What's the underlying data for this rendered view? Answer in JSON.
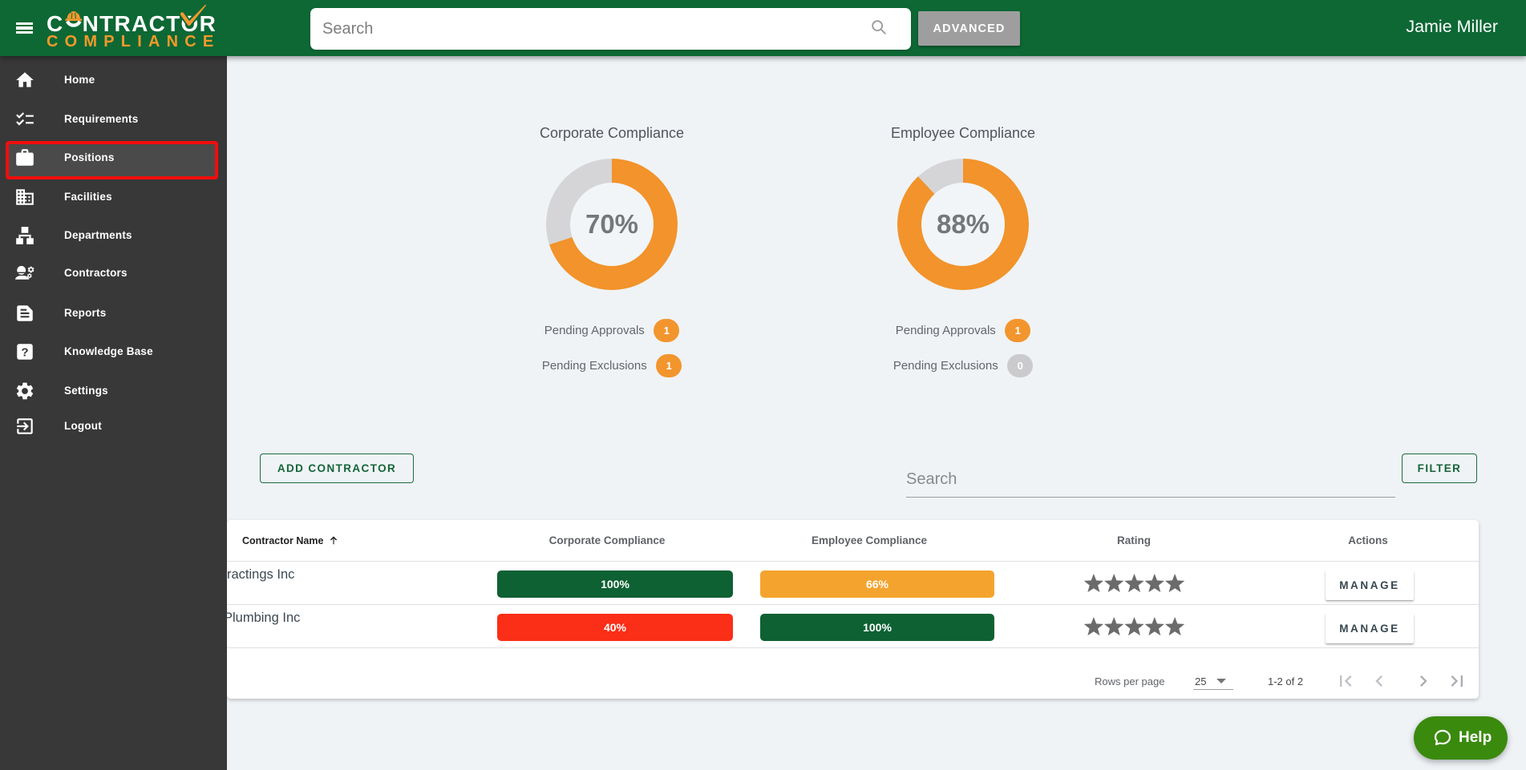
{
  "topbar": {
    "logo_line1": "CONTRACTOR",
    "logo_line2": "COMPLIANCE",
    "search_placeholder": "Search",
    "advanced_label": "ADVANCED",
    "user_name": "Jamie Miller"
  },
  "sidebar": {
    "items": [
      {
        "label": "Home"
      },
      {
        "label": "Requirements"
      },
      {
        "label": "Positions"
      },
      {
        "label": "Facilities"
      },
      {
        "label": "Departments"
      },
      {
        "label": "Contractors"
      },
      {
        "label": "Reports"
      },
      {
        "label": "Knowledge Base"
      },
      {
        "label": "Settings"
      },
      {
        "label": "Logout"
      }
    ]
  },
  "dashboard": {
    "corporate": {
      "title": "Corporate Compliance",
      "percent": "70%",
      "pending_approvals_label": "Pending Approvals",
      "pending_approvals": "1",
      "pending_exclusions_label": "Pending Exclusions",
      "pending_exclusions": "1"
    },
    "employee": {
      "title": "Employee Compliance",
      "percent": "88%",
      "pending_approvals_label": "Pending Approvals",
      "pending_approvals": "1",
      "pending_exclusions_label": "Pending Exclusions",
      "pending_exclusions": "0"
    }
  },
  "chart_data": [
    {
      "type": "pie",
      "title": "Corporate Compliance",
      "values": [
        70,
        30
      ],
      "labels": [
        "compliant",
        "remaining"
      ],
      "unit": "%",
      "center_label": "70%"
    },
    {
      "type": "pie",
      "title": "Employee Compliance",
      "values": [
        88,
        12
      ],
      "labels": [
        "compliant",
        "remaining"
      ],
      "unit": "%",
      "center_label": "88%"
    }
  ],
  "toolbar": {
    "add_contractor_label": "ADD CONTRACTOR",
    "search_placeholder": "Search",
    "filter_label": "FILTER"
  },
  "table": {
    "columns": {
      "name": "Contractor Name",
      "corporate": "Corporate Compliance",
      "employee": "Employee Compliance",
      "rating": "Rating",
      "actions": "Actions"
    },
    "rows": [
      {
        "name": "ractings Inc",
        "corporate": "100%",
        "corporate_level": "green",
        "employee": "66%",
        "employee_level": "orange",
        "rating": 5,
        "action_label": "MANAGE"
      },
      {
        "name": "Plumbing Inc",
        "corporate": "40%",
        "corporate_level": "red",
        "employee": "100%",
        "employee_level": "green",
        "rating": 5,
        "action_label": "MANAGE"
      }
    ]
  },
  "pagination": {
    "rows_per_page_label": "Rows per page",
    "rows_per_page": "25",
    "range": "1-2 of 2"
  },
  "help": {
    "label": "Help"
  }
}
